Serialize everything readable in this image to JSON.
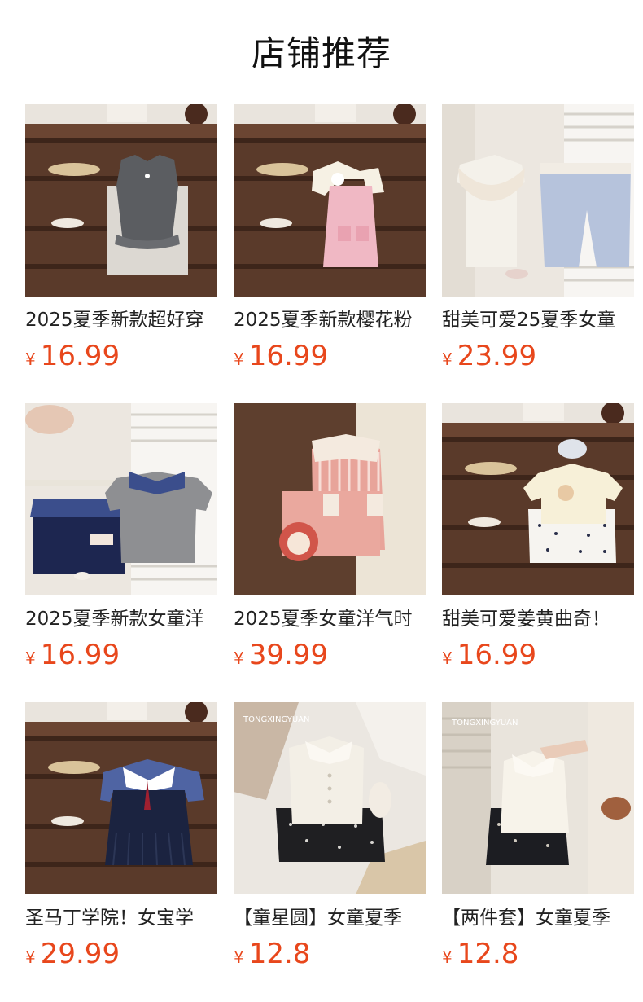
{
  "section_title": "店铺推荐",
  "currency_symbol": "¥",
  "colors": {
    "price": "#e8471c",
    "title_text": "#111111",
    "name_text": "#222222"
  },
  "products": [
    {
      "name": "2025夏季新款超好穿",
      "price": "16.99",
      "image": "shelf-photo-gray-top"
    },
    {
      "name": "2025夏季新款樱花粉",
      "price": "16.99",
      "image": "shelf-photo-pink-overall"
    },
    {
      "name": "甜美可爱25夏季女童",
      "price": "23.99",
      "image": "closet-photo-lace-top-floral-shorts"
    },
    {
      "name": "2025夏季新款女童洋",
      "price": "16.99",
      "image": "closet-photo-gingham-collar-navy-skirt"
    },
    {
      "name": "2025夏季女童洋气时",
      "price": "39.99",
      "image": "door-photo-pink-stripe-set"
    },
    {
      "name": "甜美可爱姜黄曲奇！",
      "price": "16.99",
      "image": "shelf-photo-cream-tee-dot-shorts"
    },
    {
      "name": "圣马丁学院！女宝学",
      "price": "29.99",
      "image": "shelf-photo-navy-pleated-dress"
    },
    {
      "name": "【童星圆】女童夏季",
      "price": "12.8",
      "image": "bed-photo-white-vest-dark-shorts"
    },
    {
      "name": "【两件套】女童夏季",
      "price": "12.8",
      "image": "closet-photo-white-vest-dark-skirt"
    }
  ]
}
